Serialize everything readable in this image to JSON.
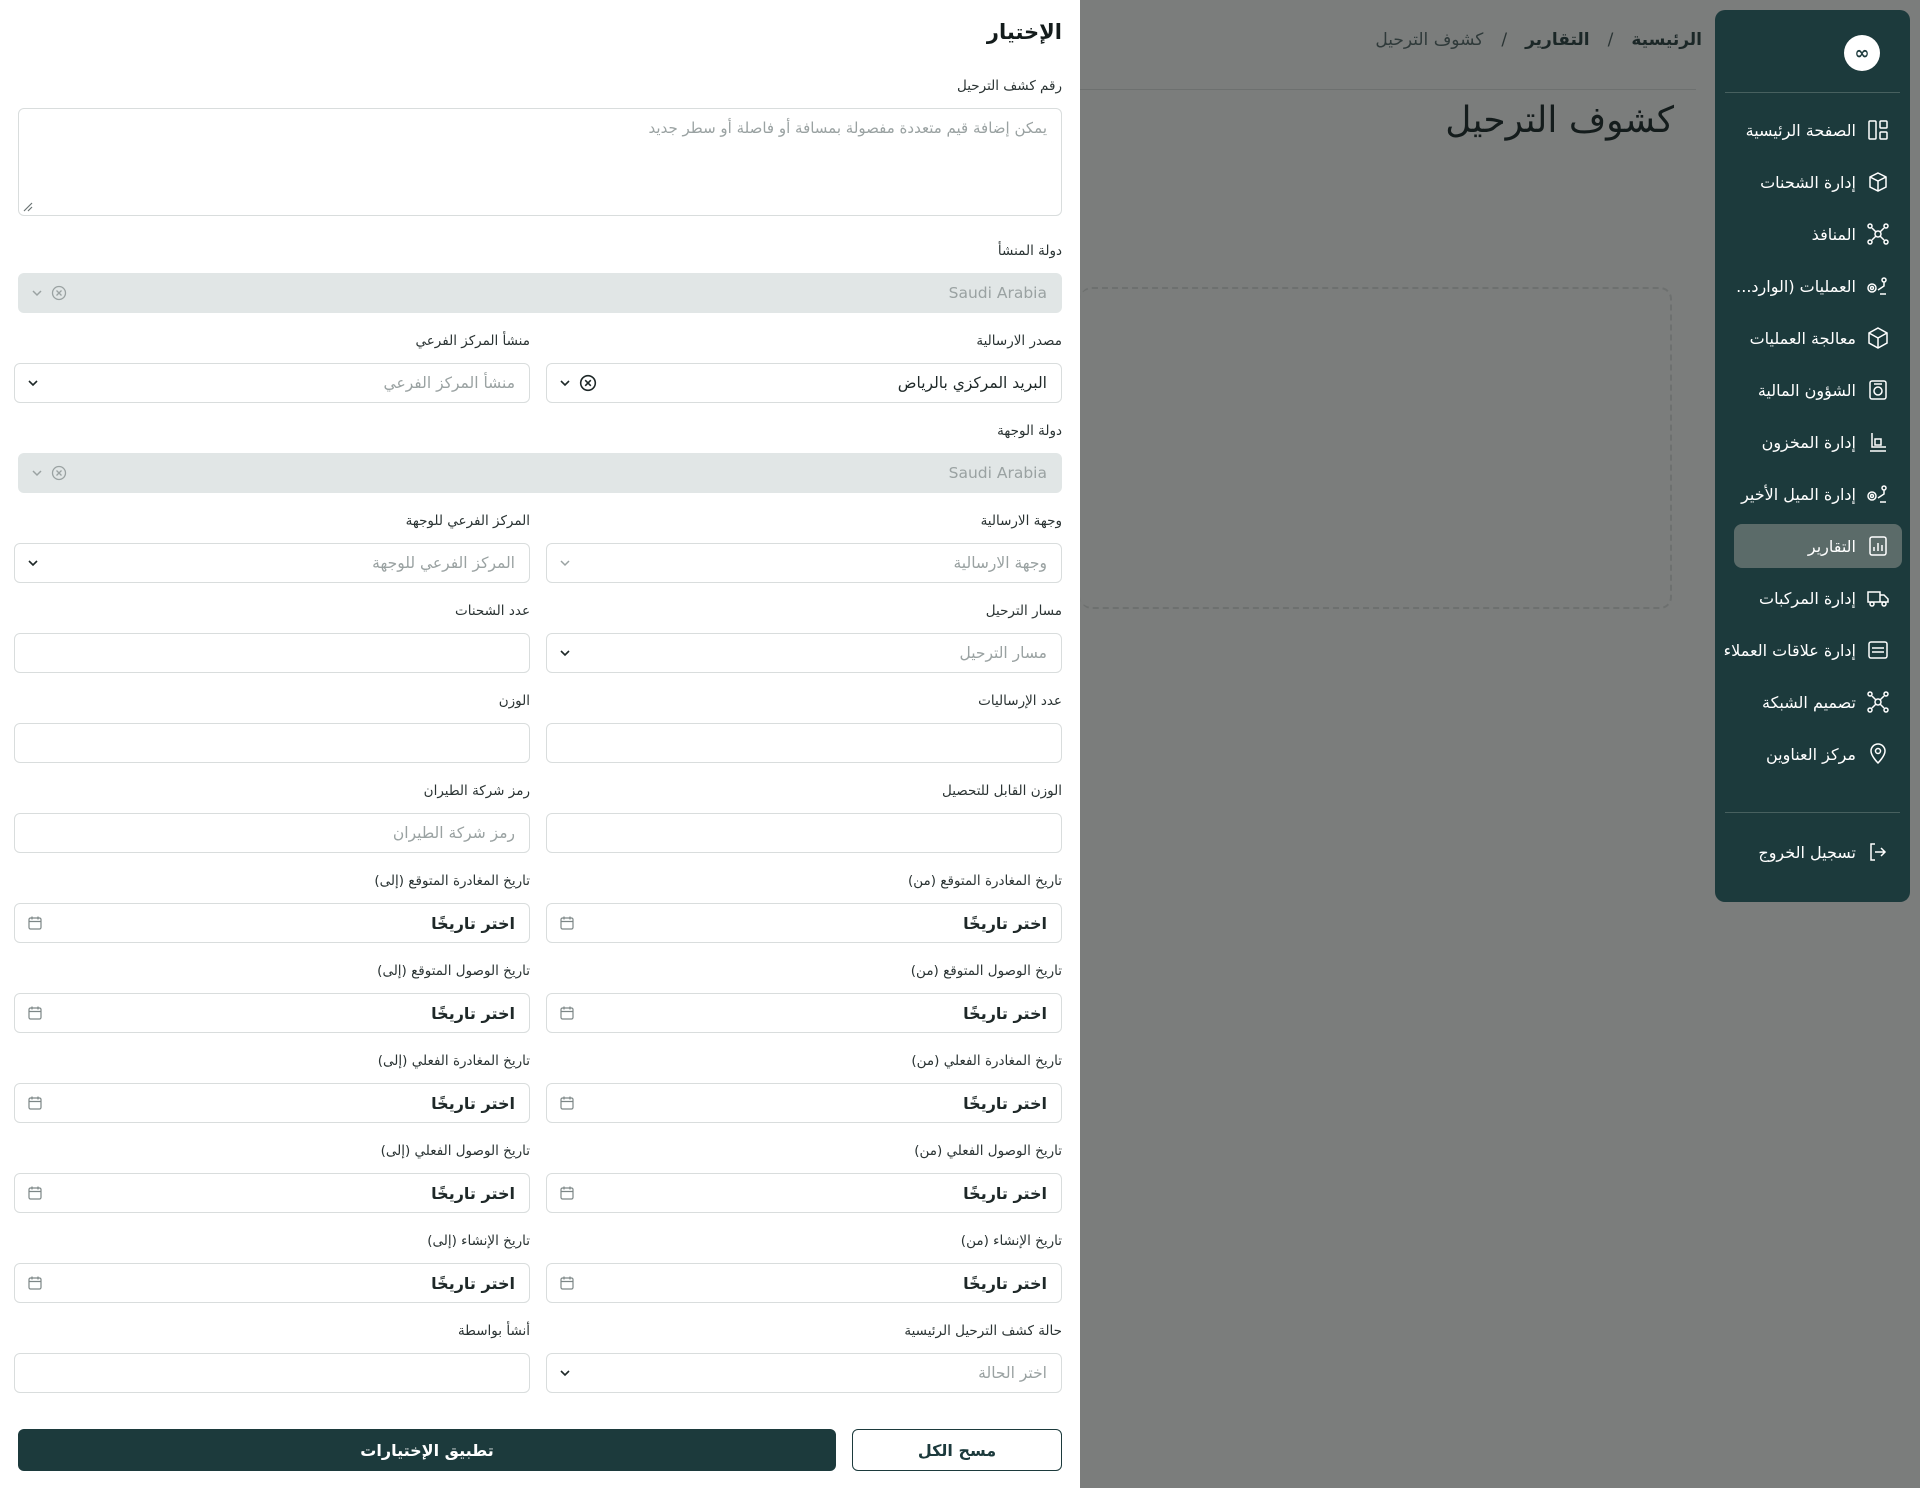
{
  "breadcrumb": {
    "home": "الرئيسية",
    "reports": "التقارير",
    "current": "كشوف الترحيل",
    "separator": "/"
  },
  "page": {
    "title": "كشوف الترحيل"
  },
  "sidebar": {
    "logo": "∞",
    "items": [
      {
        "label": "الصفحة الرئيسية",
        "icon": "dashboard-icon"
      },
      {
        "label": "إدارة الشحنات",
        "icon": "package-icon"
      },
      {
        "label": "المنافذ",
        "icon": "network-icon"
      },
      {
        "label": "العمليات (الوارد...",
        "icon": "route-icon"
      },
      {
        "label": "معالجة العمليات",
        "icon": "box-icon"
      },
      {
        "label": "الشؤون المالية",
        "icon": "finance-icon"
      },
      {
        "label": "إدارة المخزون",
        "icon": "inventory-icon"
      },
      {
        "label": "إدارة الميل الأخير",
        "icon": "last-mile-icon"
      },
      {
        "label": "التقارير",
        "icon": "reports-icon",
        "active": true
      },
      {
        "label": "إدارة المركبات",
        "icon": "truck-icon"
      },
      {
        "label": "إدارة علاقات العملاء",
        "icon": "crm-icon"
      },
      {
        "label": "تصميم الشبكة",
        "icon": "network-design-icon"
      },
      {
        "label": "مركز العناوين",
        "icon": "location-icon"
      }
    ],
    "logout": {
      "label": "تسجيل الخروج",
      "icon": "logout-icon"
    }
  },
  "filter": {
    "title": "الإختيار",
    "manifest_number": {
      "label": "رقم كشف الترحيل",
      "placeholder": "يمكن إضافة قيم متعددة مفصولة بمسافة أو فاصلة أو سطر جديد"
    },
    "origin_country": {
      "label": "دولة المنشأ",
      "value": "Saudi Arabia"
    },
    "dispatch_source": {
      "label": "مصدر الارسالية",
      "value": "البريد المركزي بالرياض"
    },
    "origin_branch": {
      "label": "منشأ المركز الفرعي",
      "placeholder": "منشأ المركز الفرعي"
    },
    "destination_country": {
      "label": "دولة الوجهة",
      "value": "Saudi Arabia"
    },
    "dispatch_destination": {
      "label": "وجهة الارسالية",
      "placeholder": "وجهة الارسالية"
    },
    "destination_branch": {
      "label": "المركز الفرعي للوجهة",
      "placeholder": "المركز الفرعي للوجهة"
    },
    "route": {
      "label": "مسار الترحيل",
      "placeholder": "مسار الترحيل"
    },
    "shipments_count": {
      "label": "عدد الشحنات"
    },
    "dispatches_count": {
      "label": "عدد الإرساليات"
    },
    "weight": {
      "label": "الوزن"
    },
    "chargeable_weight": {
      "label": "الوزن القابل للتحصيل"
    },
    "airline_code": {
      "label": "رمز شركة الطيران",
      "placeholder": "رمز شركة الطيران"
    },
    "date_placeholder": "اختر تاريخًا",
    "dates": [
      {
        "label_from": "تاريخ المغادرة المتوقع (من)",
        "label_to": "تاريخ المغادرة المتوقع (إلى)"
      },
      {
        "label_from": "تاريخ الوصول المتوقع (من)",
        "label_to": "تاريخ الوصول المتوقع (إلى)"
      },
      {
        "label_from": "تاريخ المغادرة الفعلي (من)",
        "label_to": "تاريخ المغادرة الفعلي (إلى)"
      },
      {
        "label_from": "تاريخ الوصول الفعلي (من)",
        "label_to": "تاريخ الوصول الفعلي (إلى)"
      },
      {
        "label_from": "تاريخ الإنشاء (من)",
        "label_to": "تاريخ الإنشاء (إلى)"
      }
    ],
    "status": {
      "label": "حالة كشف الترحيل الرئيسية",
      "placeholder": "اختر الحالة"
    },
    "created_by": {
      "label": "أنشأ بواسطة"
    },
    "clear_all": "مسح الكل",
    "apply": "تطبيق الإختيارات"
  },
  "colors": {
    "primary": "#1c3a3c",
    "overlay": "#7b7d7c",
    "active_item": "#5b6b69",
    "disabled_field": "#e1e6e6"
  }
}
